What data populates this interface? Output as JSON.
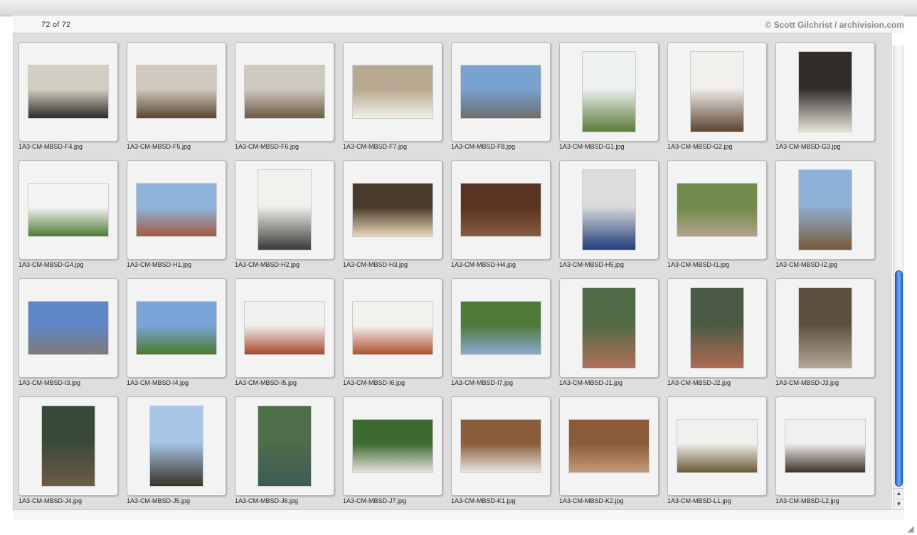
{
  "header": {
    "counter": "72 of 72",
    "copyright": "© Scott Gilchrist / archivision.com"
  },
  "icons": {
    "scroll_up": "triangle-up",
    "scroll_down": "triangle-down",
    "resize": "grip"
  },
  "thumbnails": [
    {
      "caption": "1A3-CM-MBSD-F4.jpg",
      "orientation": "landscape",
      "colors": [
        "#d4cec2",
        "#2e2a26"
      ]
    },
    {
      "caption": "1A3-CM-MBSD-F5.jpg",
      "orientation": "landscape",
      "colors": [
        "#cfc8bc",
        "#5a4632"
      ]
    },
    {
      "caption": "1A3-CM-MBSD-F6.jpg",
      "orientation": "landscape",
      "colors": [
        "#cdc8c0",
        "#6c5a44"
      ]
    },
    {
      "caption": "1A3-CM-MBSD-F7.jpg",
      "orientation": "landscape",
      "colors": [
        "#b9a890",
        "#f2efe9"
      ]
    },
    {
      "caption": "1A3-CM-MBSD-F8.jpg",
      "orientation": "landscape",
      "colors": [
        "#7aa2cf",
        "#6e6e6e"
      ]
    },
    {
      "caption": "1A3-CM-MBSD-G1.jpg",
      "orientation": "portrait",
      "colors": [
        "#eef1f2",
        "#5b7d3a"
      ]
    },
    {
      "caption": "1A3-CM-MBSD-G2.jpg",
      "orientation": "portrait",
      "colors": [
        "#f1f0ec",
        "#5c4430"
      ]
    },
    {
      "caption": "1A3-CM-MBSD-G3.jpg",
      "orientation": "portrait",
      "colors": [
        "#2e2b28",
        "#e6e2d8"
      ]
    },
    {
      "caption": "1A3-CM-MBSD-G4.jpg",
      "orientation": "landscape",
      "colors": [
        "#f4f4f2",
        "#4f7a34"
      ]
    },
    {
      "caption": "1A3-CM-MBSD-H1.jpg",
      "orientation": "landscape",
      "colors": [
        "#8fb4de",
        "#a65a3e"
      ]
    },
    {
      "caption": "1A3-CM-MBSD-H2.jpg",
      "orientation": "portrait",
      "colors": [
        "#f2f1ee",
        "#3a3a36"
      ]
    },
    {
      "caption": "1A3-CM-MBSD-H3.jpg",
      "orientation": "landscape",
      "colors": [
        "#4a3a2c",
        "#e8d6b6"
      ]
    },
    {
      "caption": "1A3-CM-MBSD-H4.jpg",
      "orientation": "landscape",
      "colors": [
        "#5a3422",
        "#8a5a3c"
      ]
    },
    {
      "caption": "1A3-CM-MBSD-H5.jpg",
      "orientation": "portrait",
      "colors": [
        "#dcdcdc",
        "#1e3d7a"
      ]
    },
    {
      "caption": "1A3-CM-MBSD-I1.jpg",
      "orientation": "landscape",
      "colors": [
        "#6f8a4a",
        "#b3a38a"
      ]
    },
    {
      "caption": "1A3-CM-MBSD-I2.jpg",
      "orientation": "portrait",
      "colors": [
        "#8fb0d6",
        "#7a5a36"
      ]
    },
    {
      "caption": "1A3-CM-MBSD-I3.jpg",
      "orientation": "landscape",
      "colors": [
        "#5f86c9",
        "#7d7a74"
      ]
    },
    {
      "caption": "1A3-CM-MBSD-I4.jpg",
      "orientation": "landscape",
      "colors": [
        "#7aa4d8",
        "#4c7a2e"
      ]
    },
    {
      "caption": "1A3-CM-MBSD-I5.jpg",
      "orientation": "landscape",
      "colors": [
        "#f0f0ee",
        "#a8482e"
      ]
    },
    {
      "caption": "1A3-CM-MBSD-I6.jpg",
      "orientation": "landscape",
      "colors": [
        "#f3f2ef",
        "#b0502f"
      ]
    },
    {
      "caption": "1A3-CM-MBSD-I7.jpg",
      "orientation": "landscape",
      "colors": [
        "#4f7a3a",
        "#8aa9d2"
      ]
    },
    {
      "caption": "1A3-CM-MBSD-J1.jpg",
      "orientation": "portrait",
      "colors": [
        "#4f6a44",
        "#b0705a"
      ]
    },
    {
      "caption": "1A3-CM-MBSD-J2.jpg",
      "orientation": "portrait",
      "colors": [
        "#4a5a44",
        "#b06a52"
      ]
    },
    {
      "caption": "1A3-CM-MBSD-J3.jpg",
      "orientation": "portrait",
      "colors": [
        "#5a4f3c",
        "#b3a795"
      ]
    },
    {
      "caption": "1A3-CM-MBSD-J4.jpg",
      "orientation": "portrait",
      "colors": [
        "#3a4a3a",
        "#6e5a48"
      ]
    },
    {
      "caption": "1A3-CM-MBSD-J5.jpg",
      "orientation": "portrait",
      "colors": [
        "#a8c6e6",
        "#3b3328"
      ]
    },
    {
      "caption": "1A3-CM-MBSD-J6.jpg",
      "orientation": "portrait",
      "colors": [
        "#4f6e4a",
        "#3d5a58"
      ]
    },
    {
      "caption": "1A3-CM-MBSD-J7.jpg",
      "orientation": "landscape",
      "colors": [
        "#3d6a2e",
        "#e4e2dc"
      ]
    },
    {
      "caption": "1A3-CM-MBSD-K1.jpg",
      "orientation": "landscape",
      "colors": [
        "#8a5c3a",
        "#e8e6e0"
      ]
    },
    {
      "caption": "1A3-CM-MBSD-K2.jpg",
      "orientation": "landscape",
      "colors": [
        "#8a5a3a",
        "#c49a76"
      ]
    },
    {
      "caption": "1A3-CM-MBSD-L1.jpg",
      "orientation": "landscape",
      "colors": [
        "#efefed",
        "#6a5a34"
      ]
    },
    {
      "caption": "1A3-CM-MBSD-L2.jpg",
      "orientation": "landscape",
      "colors": [
        "#efefed",
        "#3b3328"
      ]
    }
  ]
}
